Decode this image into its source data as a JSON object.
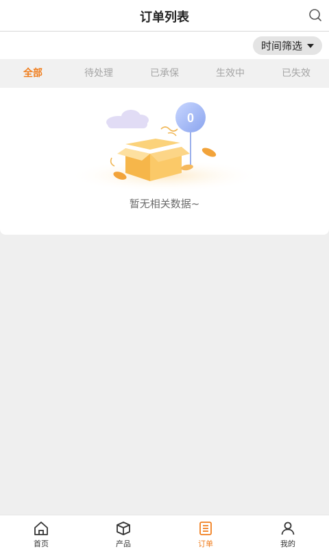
{
  "header": {
    "title": "订单列表",
    "search_icon": "search-icon"
  },
  "filter": {
    "time_label": "时间筛选"
  },
  "tabs": [
    {
      "label": "全部",
      "active": true
    },
    {
      "label": "待处理",
      "active": false
    },
    {
      "label": "已承保",
      "active": false
    },
    {
      "label": "生效中",
      "active": false
    },
    {
      "label": "已失效",
      "active": false
    }
  ],
  "empty": {
    "balloon_number": "0",
    "message": "暂无相关数据~"
  },
  "bottom_nav": [
    {
      "label": "首页",
      "icon": "home-icon",
      "active": false
    },
    {
      "label": "产品",
      "icon": "box-icon",
      "active": false
    },
    {
      "label": "订单",
      "icon": "order-list-icon",
      "active": true
    },
    {
      "label": "我的",
      "icon": "profile-icon",
      "active": false
    }
  ],
  "colors": {
    "accent": "#f07d1c",
    "inactive_tab": "#a5a5a5",
    "background": "#efefef"
  }
}
